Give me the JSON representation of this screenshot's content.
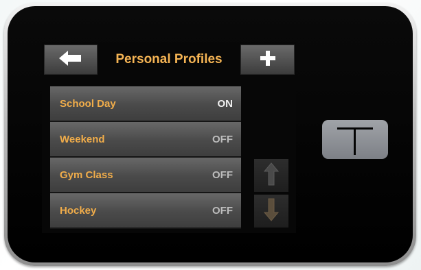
{
  "header": {
    "title": "Personal Profiles",
    "back_icon": "arrow-left-icon",
    "add_icon": "plus-icon"
  },
  "profiles": [
    {
      "name": "School Day",
      "state": "ON"
    },
    {
      "name": "Weekend",
      "state": "OFF"
    },
    {
      "name": "Gym Class",
      "state": "OFF"
    },
    {
      "name": "Hockey",
      "state": "OFF"
    }
  ],
  "scroll": {
    "up_icon": "arrow-up-icon",
    "down_icon": "arrow-down-icon"
  },
  "device": {
    "button_icon": "t-logo-icon"
  },
  "colors": {
    "accent": "#f5b454",
    "label": "#f1ad4a",
    "screen_bg": "#070707",
    "row_bg": "#5a5a5a"
  }
}
